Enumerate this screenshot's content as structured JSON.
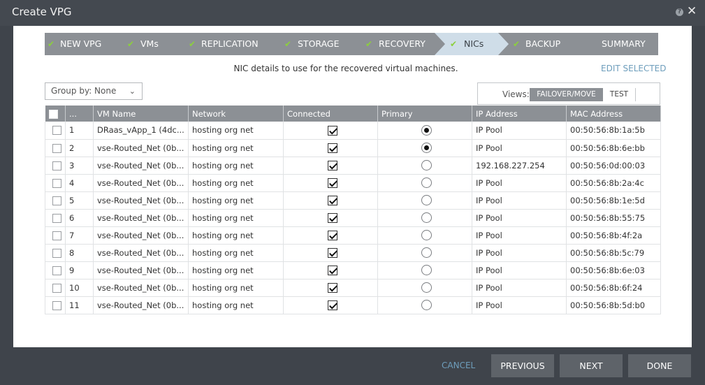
{
  "window": {
    "title": "Create VPG",
    "help_icon_label": "?",
    "close_icon_label": "✕"
  },
  "wizard": {
    "steps": [
      {
        "label": "NEW VPG",
        "check": "✔"
      },
      {
        "label": "VMs",
        "check": "✔"
      },
      {
        "label": "REPLICATION",
        "check": "✔"
      },
      {
        "label": "STORAGE",
        "check": "✔"
      },
      {
        "label": "RECOVERY",
        "check": "✔"
      },
      {
        "label": "NICs",
        "check": "✔",
        "active": true
      },
      {
        "label": "BACKUP",
        "check": "✔"
      },
      {
        "label": "SUMMARY"
      }
    ]
  },
  "main": {
    "description": "NIC details to use for the recovered virtual machines.",
    "edit_selected": "EDIT SELECTED",
    "group_by": {
      "label": "Group by: None",
      "chevron": "⌄"
    },
    "views": {
      "label": "Views:",
      "failover": "FAILOVER/MOVE",
      "test": "TEST"
    }
  },
  "table": {
    "columns": [
      "...",
      "VM Name",
      "Network",
      "Connected",
      "Primary",
      "IP Address",
      "MAC Address"
    ],
    "rows": [
      {
        "num": "1",
        "vm": "DRaas_vApp_1 (4dc...",
        "network": "hosting org net",
        "connected": true,
        "primary": true,
        "ip": "IP Pool",
        "mac": "00:50:56:8b:1a:5b"
      },
      {
        "num": "2",
        "vm": "vse-Routed_Net (0b...",
        "network": "hosting org net",
        "connected": true,
        "primary": true,
        "ip": "IP Pool",
        "mac": "00:50:56:8b:6e:bb"
      },
      {
        "num": "3",
        "vm": "vse-Routed_Net (0b...",
        "network": "hosting org net",
        "connected": true,
        "primary": false,
        "ip": "192.168.227.254",
        "mac": "00:50:56:0d:00:03"
      },
      {
        "num": "4",
        "vm": "vse-Routed_Net (0b...",
        "network": "hosting org net",
        "connected": true,
        "primary": false,
        "ip": "IP Pool",
        "mac": "00:50:56:8b:2a:4c"
      },
      {
        "num": "5",
        "vm": "vse-Routed_Net (0b...",
        "network": "hosting org net",
        "connected": true,
        "primary": false,
        "ip": "IP Pool",
        "mac": "00:50:56:8b:1e:5d"
      },
      {
        "num": "6",
        "vm": "vse-Routed_Net (0b...",
        "network": "hosting org net",
        "connected": true,
        "primary": false,
        "ip": "IP Pool",
        "mac": "00:50:56:8b:55:75"
      },
      {
        "num": "7",
        "vm": "vse-Routed_Net (0b...",
        "network": "hosting org net",
        "connected": true,
        "primary": false,
        "ip": "IP Pool",
        "mac": "00:50:56:8b:4f:2a"
      },
      {
        "num": "8",
        "vm": "vse-Routed_Net (0b...",
        "network": "hosting org net",
        "connected": true,
        "primary": false,
        "ip": "IP Pool",
        "mac": "00:50:56:8b:5c:79"
      },
      {
        "num": "9",
        "vm": "vse-Routed_Net (0b...",
        "network": "hosting org net",
        "connected": true,
        "primary": false,
        "ip": "IP Pool",
        "mac": "00:50:56:8b:6e:03"
      },
      {
        "num": "10",
        "vm": "vse-Routed_Net (0b...",
        "network": "hosting org net",
        "connected": true,
        "primary": false,
        "ip": "IP Pool",
        "mac": "00:50:56:8b:6f:24"
      },
      {
        "num": "11",
        "vm": "vse-Routed_Net (0b...",
        "network": "hosting org net",
        "connected": true,
        "primary": false,
        "ip": "IP Pool",
        "mac": "00:50:56:8b:5d:b0"
      }
    ]
  },
  "footer": {
    "cancel": "CANCEL",
    "previous": "PREVIOUS",
    "next": "NEXT",
    "done": "DONE"
  },
  "colors": {
    "accent_link": "#6e9ebc",
    "check_green": "#8cd03c",
    "header_gray": "#8c9095",
    "active_step": "#cfdde8"
  }
}
